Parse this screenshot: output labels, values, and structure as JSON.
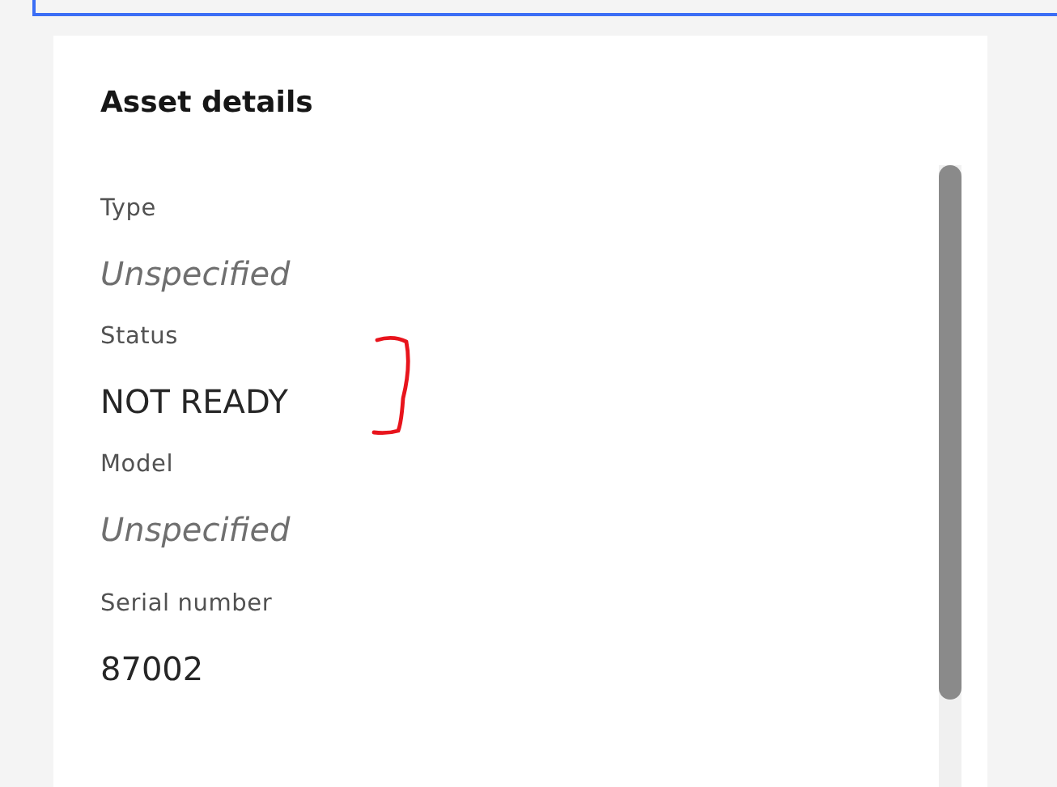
{
  "panel": {
    "title": "Asset details"
  },
  "fields": [
    {
      "label": "Type",
      "value": "Unspecified",
      "kind": "empty"
    },
    {
      "label": "Status",
      "value": "NOT READY",
      "kind": "text"
    },
    {
      "label": "Model",
      "value": "Unspecified",
      "kind": "empty"
    },
    {
      "label": "Serial number",
      "value": "87002",
      "kind": "text"
    }
  ]
}
